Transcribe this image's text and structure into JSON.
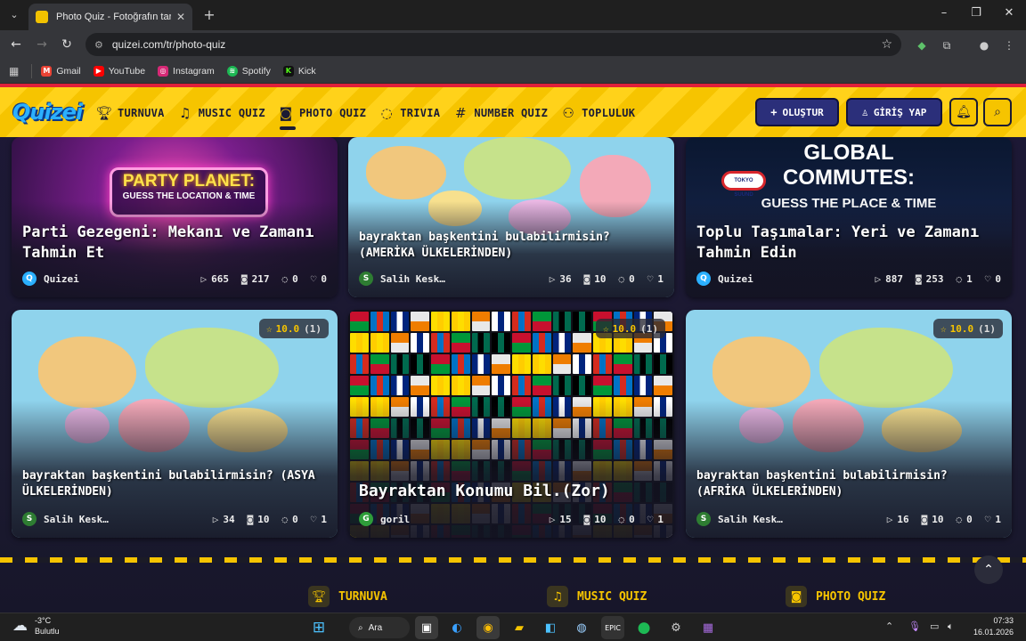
{
  "browser": {
    "tab_title": "Photo Quiz - Fotoğrafın tarihini",
    "url": "quizei.com/tr/photo-quiz",
    "bookmarks": [
      {
        "label": "Gmail",
        "icon": "gmail-icon",
        "color": "#ea4335"
      },
      {
        "label": "YouTube",
        "icon": "youtube-icon",
        "color": "#ff0000"
      },
      {
        "label": "Instagram",
        "icon": "instagram-icon",
        "color": "#d62976"
      },
      {
        "label": "Spotify",
        "icon": "spotify-icon",
        "color": "#1db954"
      },
      {
        "label": "Kick",
        "icon": "kick-icon",
        "color": "#53fc18"
      }
    ]
  },
  "site": {
    "logo": "Quizei",
    "nav": [
      {
        "label": "TURNUVA",
        "icon": "trophy-icon"
      },
      {
        "label": "MUSIC QUIZ",
        "icon": "music-note-icon"
      },
      {
        "label": "PHOTO QUIZ",
        "icon": "camera-icon"
      },
      {
        "label": "TRIVIA",
        "icon": "chat-bubble-icon"
      },
      {
        "label": "NUMBER QUIZ",
        "icon": "hash-icon"
      },
      {
        "label": "TOPLULUK",
        "icon": "users-icon"
      }
    ],
    "create_button": "OLUŞTUR",
    "login_button": "GİRİŞ YAP"
  },
  "cards": [
    {
      "title": "Parti Gezegeni: Mekanı ve Zamanı Tahmin Et",
      "image_text_1": "PARTY PLANET:",
      "image_text_2": "GUESS THE LOCATION & TIME",
      "author": "Quizei",
      "author_initial": "Q",
      "plays": "665",
      "photos": "217",
      "comments": "0",
      "likes": "0"
    },
    {
      "title": "bayraktan başkentini bulabilirmisin? (AMERİKA ÜLKELERİNDEN)",
      "author": "Salih Kesk…",
      "author_initial": "S",
      "plays": "36",
      "photos": "10",
      "comments": "0",
      "likes": "1"
    },
    {
      "title": "Toplu Taşımalar: Yeri ve Zamanı Tahmin Edin",
      "image_text_1": "GLOBAL",
      "image_text_2": "COMMUTES:",
      "image_text_3": "GUESS THE PLACE & TIME",
      "image_text_4": "TOKYO SUUND",
      "author": "Quizei",
      "author_initial": "Q",
      "plays": "887",
      "photos": "253",
      "comments": "1",
      "likes": "0"
    },
    {
      "title": "bayraktan başkentini bulabilirmisin? (ASYA ÜLKELERİNDEN)",
      "rating_score": "10.0",
      "rating_count": "(1)",
      "author": "Salih Kesk…",
      "author_initial": "S",
      "plays": "34",
      "photos": "10",
      "comments": "0",
      "likes": "1"
    },
    {
      "title": "Bayraktan Konumu Bil.(Zor)",
      "rating_score": "10.0",
      "rating_count": "(1)",
      "author": "goril",
      "author_initial": "G",
      "plays": "15",
      "photos": "10",
      "comments": "0",
      "likes": "1"
    },
    {
      "title": "bayraktan başkentini bulabilirmisin? (AFRİKA ÜLKELERİNDEN)",
      "rating_score": "10.0",
      "rating_count": "(1)",
      "author": "Salih Kesk…",
      "author_initial": "S",
      "plays": "16",
      "photos": "10",
      "comments": "0",
      "likes": "1"
    }
  ],
  "footer": {
    "nav": [
      {
        "label": "TURNUVA",
        "icon": "trophy-icon"
      },
      {
        "label": "MUSIC QUIZ",
        "icon": "music-note-icon"
      },
      {
        "label": "PHOTO QUIZ",
        "icon": "camera-icon"
      }
    ]
  },
  "taskbar": {
    "temperature": "-3°C",
    "weather": "Bulutlu",
    "search": "Ara",
    "time": "07:33",
    "date": "16.01.2026"
  },
  "colors": {
    "brand_yellow": "#f6c400",
    "header_red": "#e0203a",
    "button_blue": "#2b2f7a",
    "page_bg": "#1d1836"
  }
}
